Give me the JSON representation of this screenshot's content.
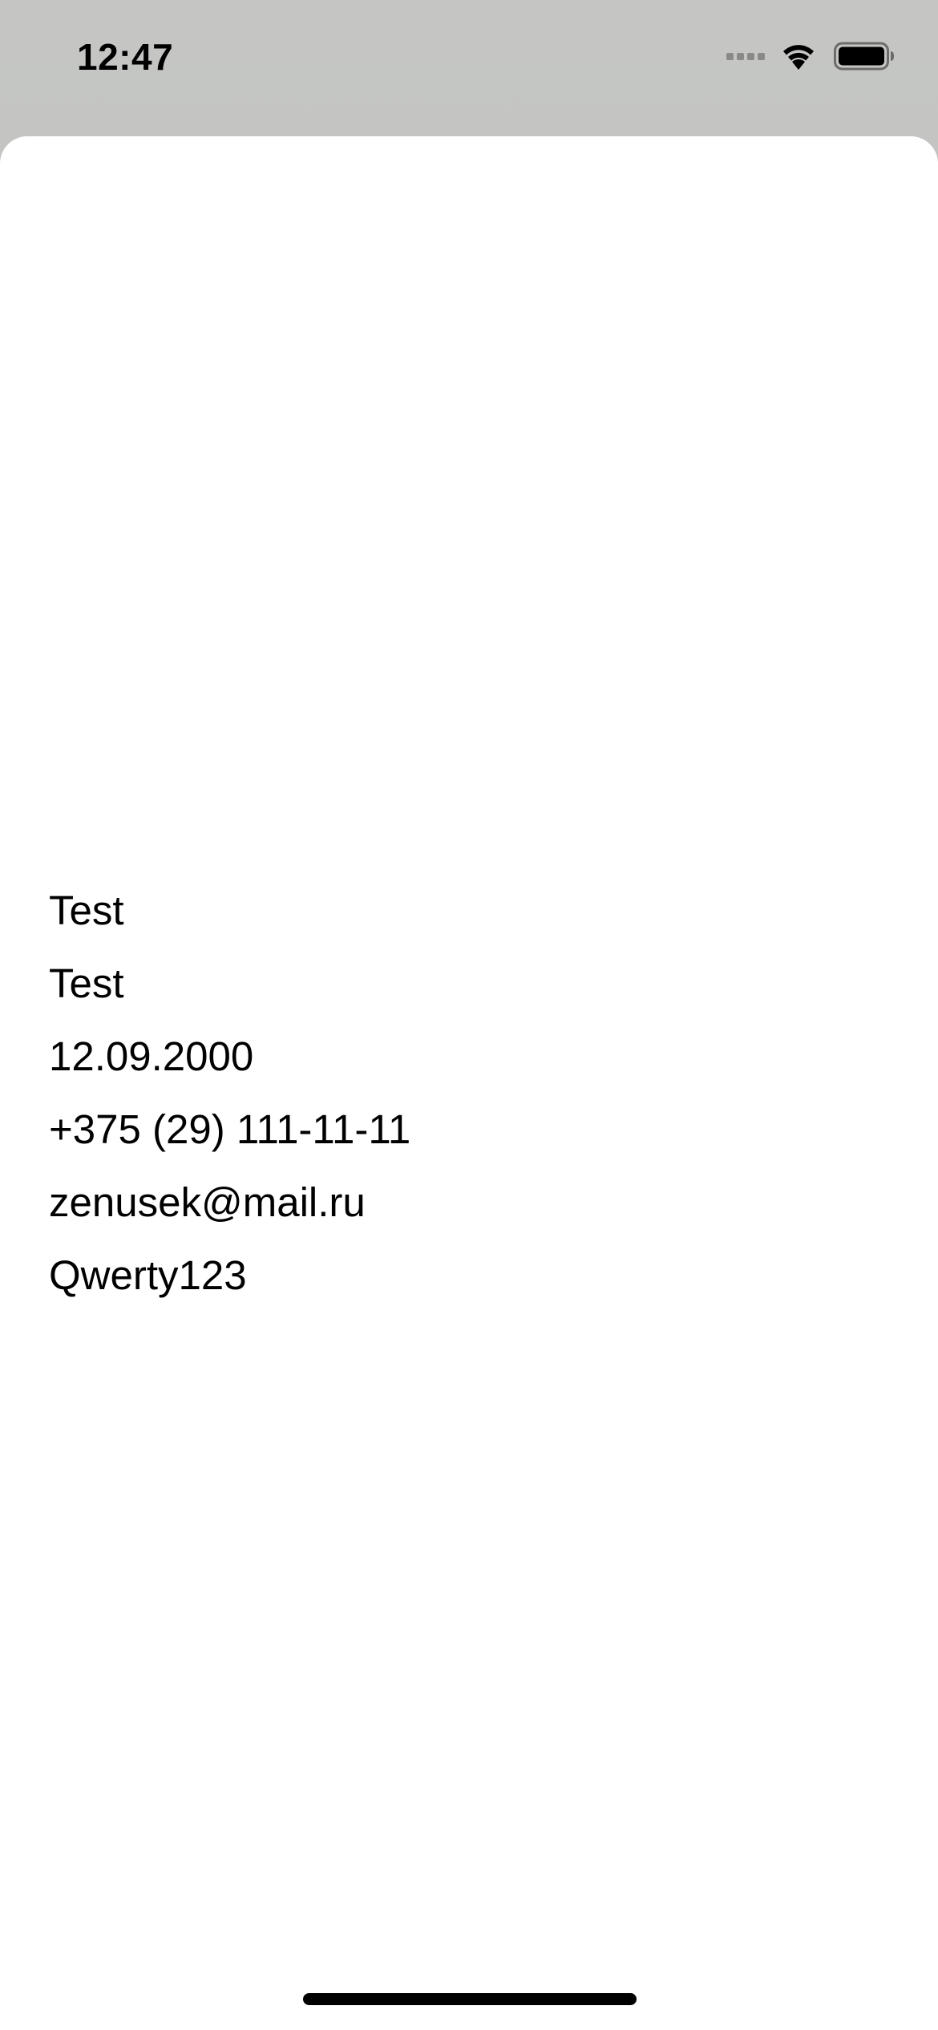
{
  "status_bar": {
    "time": "12:47",
    "icons": [
      "cellular-signal-icon",
      "wifi-icon",
      "battery-icon"
    ]
  },
  "profile": {
    "first_name": "Test",
    "last_name": "Test",
    "birth_date": "12.09.2000",
    "phone": "+375 (29) 111-11-11",
    "email": "zenusek@mail.ru",
    "password": "Qwerty123"
  },
  "colors": {
    "background": "#ffffff",
    "status_bar_background": "#c0c1bf",
    "text": "#000000"
  }
}
